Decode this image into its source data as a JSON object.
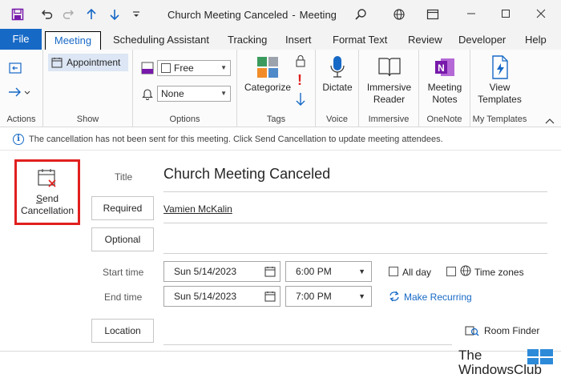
{
  "window": {
    "title": "Church Meeting Canceled",
    "separator": "-",
    "app_type": "Meeting"
  },
  "tabs": [
    "File",
    "Meeting",
    "Scheduling Assistant",
    "Tracking",
    "Insert",
    "Format Text",
    "Review",
    "Developer",
    "Help"
  ],
  "ribbon": {
    "actions": {
      "label": "Actions"
    },
    "show": {
      "appointment": "Appointment",
      "label": "Show"
    },
    "options": {
      "show_as": "Free",
      "reminder": "None",
      "label": "Options"
    },
    "tags": {
      "categorize": "Categorize",
      "label": "Tags"
    },
    "voice": {
      "dictate": "Dictate",
      "label": "Voice"
    },
    "immersive": {
      "reader_line1": "Immersive",
      "reader_line2": "Reader",
      "label": "Immersive"
    },
    "onenote": {
      "line1": "Meeting",
      "line2": "Notes",
      "label": "OneNote"
    },
    "templates": {
      "line1": "View",
      "line2": "Templates",
      "label": "My Templates"
    }
  },
  "infobar": {
    "message": "The cancellation has not been sent for this meeting. Click Send Cancellation to update meeting attendees."
  },
  "form": {
    "send": {
      "line1": "Send",
      "line2": "Cancellation"
    },
    "title_label": "Title",
    "title_value": "Church Meeting Canceled",
    "required_label": "Required",
    "required_value": "Vamien McKalin",
    "optional_label": "Optional",
    "start_time_label": "Start time",
    "start_date": "Sun 5/14/2023",
    "start_time": "6:00 PM",
    "end_time_label": "End time",
    "end_date": "Sun 5/14/2023",
    "end_time": "7:00 PM",
    "all_day": "All day",
    "time_zones": "Time zones",
    "make_recurring": "Make Recurring",
    "location_label": "Location",
    "room_finder": "Room Finder"
  },
  "watermark": {
    "line1": "The",
    "line2": "WindowsClub"
  },
  "colors": {
    "accent": "#1769c6",
    "highlight_box": "#e0201e",
    "onenote": "#7719aa"
  }
}
